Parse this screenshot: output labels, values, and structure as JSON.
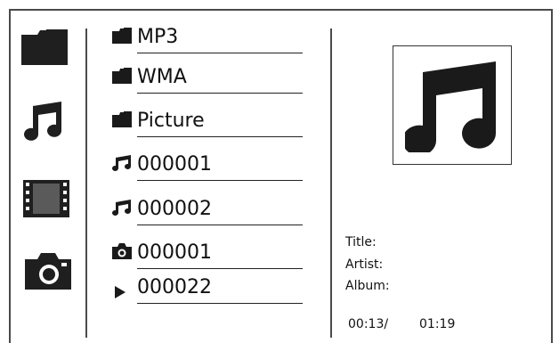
{
  "categories": [
    {
      "name": "folder",
      "icon": "folder-icon"
    },
    {
      "name": "music",
      "icon": "music-note-icon"
    },
    {
      "name": "video",
      "icon": "film-strip-icon"
    },
    {
      "name": "photo",
      "icon": "camera-icon"
    }
  ],
  "file_list": {
    "items": [
      {
        "label": "MP3",
        "icon": "folder-icon"
      },
      {
        "label": "WMA",
        "icon": "folder-icon"
      },
      {
        "label": "Picture",
        "icon": "folder-icon"
      },
      {
        "label": "000001",
        "icon": "music-note-icon"
      },
      {
        "label": "000002",
        "icon": "music-note-icon"
      },
      {
        "label": "000001",
        "icon": "camera-icon"
      },
      {
        "label": "000022",
        "icon": "play-icon"
      }
    ]
  },
  "info_panel": {
    "album_art_icon": "music-note-icon",
    "title_label": "Title:",
    "artist_label": "Artist:",
    "album_label": "Album:",
    "elapsed": "00:13/",
    "total": "01:19"
  }
}
